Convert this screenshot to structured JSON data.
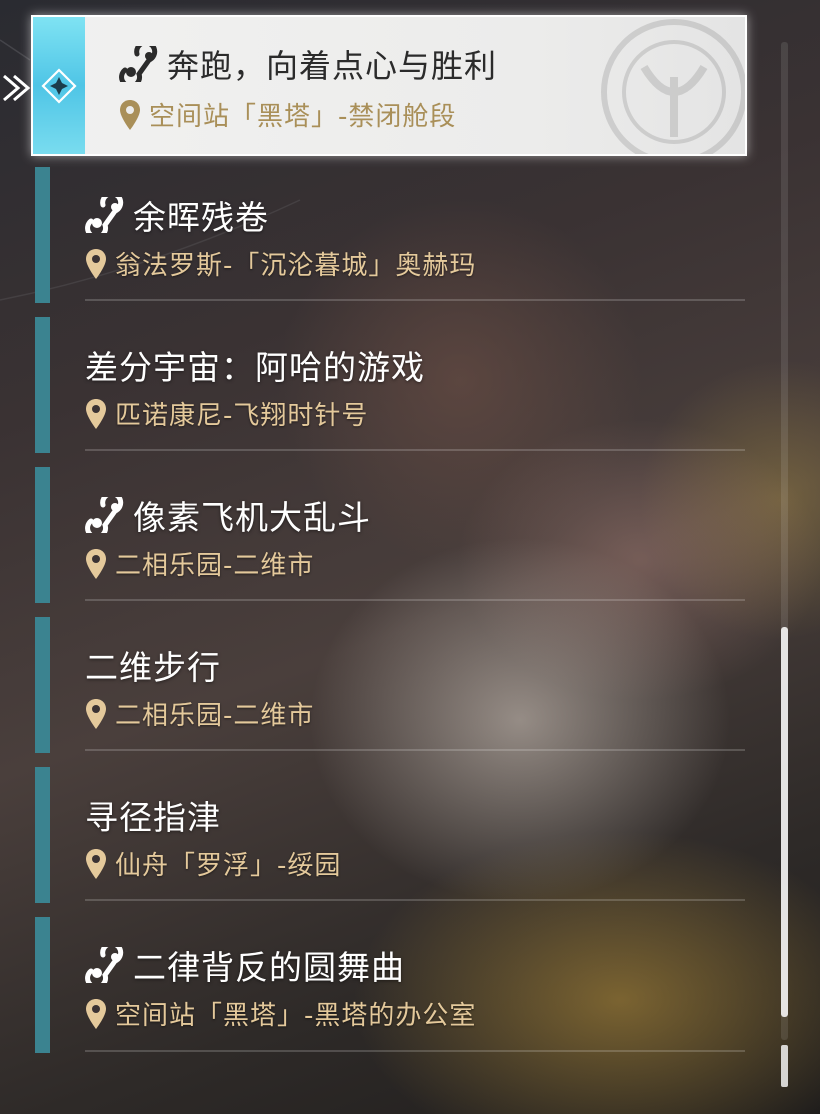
{
  "selected": {
    "title": "奔跑，向着点心与胜利",
    "location": "空间站「黑塔」-禁闭舱段",
    "has_quest_icon": true
  },
  "items": [
    {
      "title": "余晖残卷",
      "location": "翁法罗斯-「沉沦暮城」奥赫玛",
      "has_quest_icon": true
    },
    {
      "title": "差分宇宙：阿哈的游戏",
      "location": "匹诺康尼-飞翔时针号",
      "has_quest_icon": false
    },
    {
      "title": "像素飞机大乱斗",
      "location": "二相乐园-二维市",
      "has_quest_icon": true
    },
    {
      "title": "二维步行",
      "location": "二相乐园-二维市",
      "has_quest_icon": false
    },
    {
      "title": "寻径指津",
      "location": "仙舟「罗浮」-绥园",
      "has_quest_icon": false
    },
    {
      "title": "二律背反的圆舞曲",
      "location": "空间站「黑塔」-黑塔的办公室",
      "has_quest_icon": true
    }
  ],
  "icons": {
    "quest": "quest-link-icon",
    "location": "location-pin-icon",
    "selected_marker": "diamond-star-icon",
    "pointer": "chevron-right-icon"
  },
  "colors": {
    "accent_cyan": "#5fd0ea",
    "item_bar": "#3b8390",
    "location_text": "#e4c99b",
    "selected_location_text": "#a98f58"
  }
}
